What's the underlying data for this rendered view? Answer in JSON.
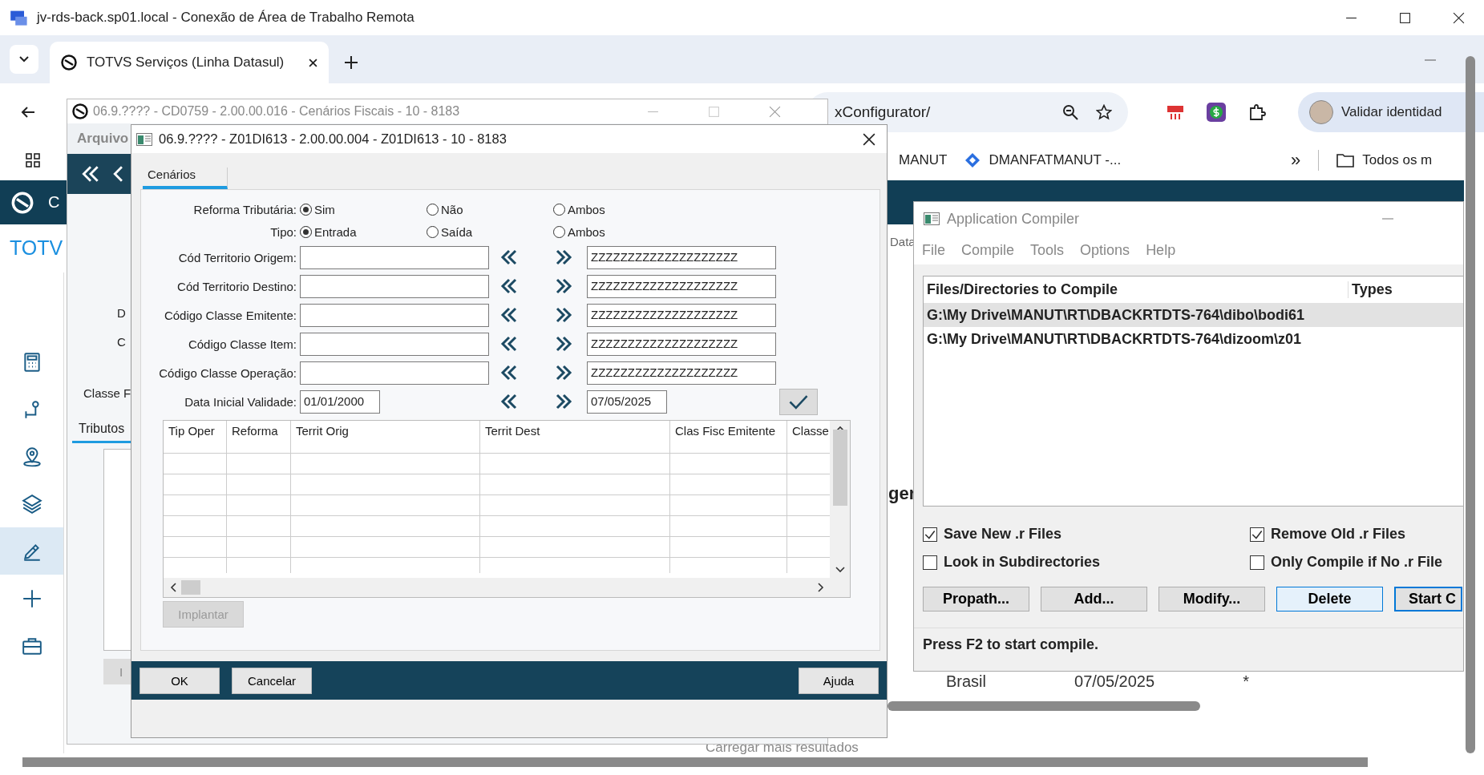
{
  "remote_window": {
    "title": "jv-rds-back.sp01.local - Conexão de Área de Trabalho Remota"
  },
  "browser": {
    "tab": {
      "title": "TOTVS Serviços (Linha Datasul)",
      "selected": true
    },
    "address": "xConfigurator/",
    "profile_button": "Validar identidad",
    "bookmarks": [
      {
        "label": "MANUT",
        "kind": "plain"
      },
      {
        "label": "DMANFATMANUT -...",
        "kind": "diamond"
      },
      {
        "label": "»",
        "kind": "overflow"
      },
      {
        "label": "Todos os m",
        "kind": "folder"
      }
    ]
  },
  "page": {
    "header_letter": "C",
    "brand": "TOTV",
    "sidebar": [
      {
        "kind": "calculator",
        "selected": false
      },
      {
        "kind": "pin",
        "selected": false
      },
      {
        "kind": "location",
        "selected": false
      },
      {
        "kind": "layers",
        "selected": false
      },
      {
        "kind": "edit",
        "selected": true
      },
      {
        "kind": "plus",
        "selected": false
      },
      {
        "kind": "briefcase",
        "selected": false
      }
    ],
    "column_label": "Data",
    "heading_fragment": "ger",
    "row": [
      "Brasil",
      "07/05/2025",
      "*"
    ],
    "load_more": "Carregar mais resultados"
  },
  "back_window": {
    "title": "06.9.???? - CD0759 - 2.00.00.016 - Cenários Fiscais - 10 - 8183",
    "menu": [
      "Arquivo"
    ],
    "labels": [
      "D",
      "C",
      "Classe F"
    ],
    "tab": {
      "label": "Tributos",
      "selected": true
    },
    "button": "I"
  },
  "dialog": {
    "title": "06.9.???? - Z01DI613 - 2.00.00.004 - Z01DI613 - 10 - 8183",
    "tab": {
      "label": "Cenários",
      "selected": true
    },
    "radio_groups": [
      {
        "label": "Reforma Tributária:",
        "options": [
          {
            "label": "Sim",
            "selected": true
          },
          {
            "label": "Não",
            "selected": false
          },
          {
            "label": "Ambos",
            "selected": false
          }
        ]
      },
      {
        "label": "Tipo:",
        "options": [
          {
            "label": "Entrada",
            "selected": true
          },
          {
            "label": "Saída",
            "selected": false
          },
          {
            "label": "Ambos",
            "selected": false
          }
        ]
      }
    ],
    "ranges": [
      {
        "label": "Cód Territorio Origem:",
        "kind": "text",
        "to": "ZZZZZZZZZZZZZZZZZZZZ"
      },
      {
        "label": "Cód Territorio Destino:",
        "kind": "text",
        "to": "ZZZZZZZZZZZZZZZZZZZZ"
      },
      {
        "label": "Código Classe Emitente:",
        "kind": "text",
        "to": "ZZZZZZZZZZZZZZZZZZZZ"
      },
      {
        "label": "Código Classe Item:",
        "kind": "text",
        "to": "ZZZZZZZZZZZZZZZZZZZZ"
      },
      {
        "label": "Código Classe Operação:",
        "kind": "text",
        "to": "ZZZZZZZZZZZZZZZZZZZZ"
      },
      {
        "label": "Data Inicial Validade:",
        "kind": "date",
        "from": "01/01/2000",
        "to": "07/05/2025"
      }
    ],
    "grid": {
      "columns": [
        "Tip Oper",
        "Reforma",
        "Territ Orig",
        "Territ Dest",
        "Clas Fisc Emitente",
        "Classe"
      ]
    },
    "implant_button": {
      "label": "Implantar",
      "disabled": true
    },
    "buttons": [
      {
        "label": "OK"
      },
      {
        "label": "Cancelar"
      },
      {
        "label": "Ajuda"
      }
    ]
  },
  "compiler": {
    "title": "Application Compiler",
    "menu": [
      "File",
      "Compile",
      "Tools",
      "Options",
      "Help"
    ],
    "columns": [
      "Files/Directories to Compile",
      "Types"
    ],
    "rows": [
      {
        "path": "G:\\My Drive\\MANUT\\RT\\DBACKRTDTS-764\\dibo\\bodi61",
        "selected": true
      },
      {
        "path": "G:\\My Drive\\MANUT\\RT\\DBACKRTDTS-764\\dizoom\\z01",
        "selected": false
      }
    ],
    "options": [
      {
        "label": "Save New .r Files",
        "checked": true
      },
      {
        "label": "Remove Old .r Files",
        "checked": true
      },
      {
        "label": "Look in Subdirectories",
        "checked": false
      },
      {
        "label": "Only Compile if No .r File",
        "checked": false
      }
    ],
    "buttons": [
      {
        "label": "Propath...",
        "focused": false,
        "default": false
      },
      {
        "label": "Add...",
        "focused": false,
        "default": false
      },
      {
        "label": "Modify...",
        "focused": false,
        "default": false
      },
      {
        "label": "Delete",
        "focused": true,
        "default": false
      },
      {
        "label": "Start C",
        "focused": false,
        "default": true
      }
    ],
    "status": "Press F2 to start compile."
  }
}
